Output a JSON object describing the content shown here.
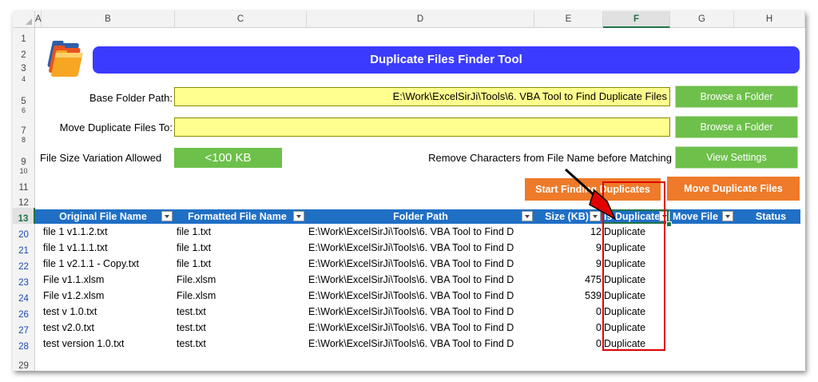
{
  "columns": [
    "A",
    "B",
    "C",
    "D",
    "E",
    "F",
    "G",
    "H"
  ],
  "selected_column": "F",
  "rows": [
    "1",
    "2",
    "3",
    "4",
    "5",
    "6",
    "7",
    "8",
    "9",
    "10",
    "11",
    "12",
    "13",
    "20",
    "21",
    "22",
    "23",
    "24",
    "26",
    "27",
    "28",
    "29"
  ],
  "header": {
    "title": "Duplicate Files Finder Tool"
  },
  "form": {
    "base_folder_label": "Base Folder Path:",
    "base_folder_value": "E:\\Work\\ExcelSirJi\\Tools\\6. VBA Tool to Find Duplicate Files",
    "move_to_label": "Move Duplicate Files To:",
    "move_to_value": "",
    "size_variation_label": "File Size Variation Allowed",
    "size_variation_value": "<100 KB",
    "remove_chars_label": "Remove Characters from File Name before Matching"
  },
  "buttons": {
    "browse1": "Browse a Folder",
    "browse2": "Browse a Folder",
    "view_settings": "View Settings",
    "start_finding": "Start Finding Duplicates",
    "move_duplicates": "Move Duplicate Files"
  },
  "table": {
    "headers": [
      "Original File Name",
      "Formatted File Name",
      "Folder Path",
      "Size (KB)",
      "Is Duplicate",
      "Move File",
      "Status"
    ],
    "rows": [
      {
        "original": "file 1 v1.1.2.txt",
        "formatted": "file 1.txt",
        "folder": "E:\\Work\\ExcelSirJi\\Tools\\6. VBA Tool to Find D",
        "size": "12",
        "dup": "Duplicate"
      },
      {
        "original": "file 1 v1.1.1.txt",
        "formatted": "file 1.txt",
        "folder": "E:\\Work\\ExcelSirJi\\Tools\\6. VBA Tool to Find D",
        "size": "9",
        "dup": "Duplicate"
      },
      {
        "original": "file 1 v2.1.1 - Copy.txt",
        "formatted": "file 1.txt",
        "folder": "E:\\Work\\ExcelSirJi\\Tools\\6. VBA Tool to Find D",
        "size": "9",
        "dup": "Duplicate"
      },
      {
        "original": "File v1.1.xlsm",
        "formatted": "File.xlsm",
        "folder": "E:\\Work\\ExcelSirJi\\Tools\\6. VBA Tool to Find D",
        "size": "475",
        "dup": "Duplicate"
      },
      {
        "original": "File v1.2.xlsm",
        "formatted": "File.xlsm",
        "folder": "E:\\Work\\ExcelSirJi\\Tools\\6. VBA Tool to Find D",
        "size": "539",
        "dup": "Duplicate"
      },
      {
        "original": "test v 1.0.txt",
        "formatted": "test.txt",
        "folder": "E:\\Work\\ExcelSirJi\\Tools\\6. VBA Tool to Find D",
        "size": "0",
        "dup": "Duplicate"
      },
      {
        "original": "test v2.0.txt",
        "formatted": "test.txt",
        "folder": "E:\\Work\\ExcelSirJi\\Tools\\6. VBA Tool to Find D",
        "size": "0",
        "dup": "Duplicate"
      },
      {
        "original": "test version 1.0.txt",
        "formatted": "test.txt",
        "folder": "E:\\Work\\ExcelSirJi\\Tools\\6. VBA Tool to Find D",
        "size": "0",
        "dup": "Duplicate"
      }
    ]
  },
  "colors": {
    "banner": "#3b3bff",
    "input_fill": "#ffff8f",
    "green_button": "#6dc04a",
    "orange_button": "#ee7a2a",
    "table_header": "#1f6fc5",
    "highlight_box": "#e00000",
    "arrow": "#e00000"
  },
  "icons": [
    "folders-icon",
    "filter-dropdown-icon",
    "pointer-arrow-icon"
  ]
}
